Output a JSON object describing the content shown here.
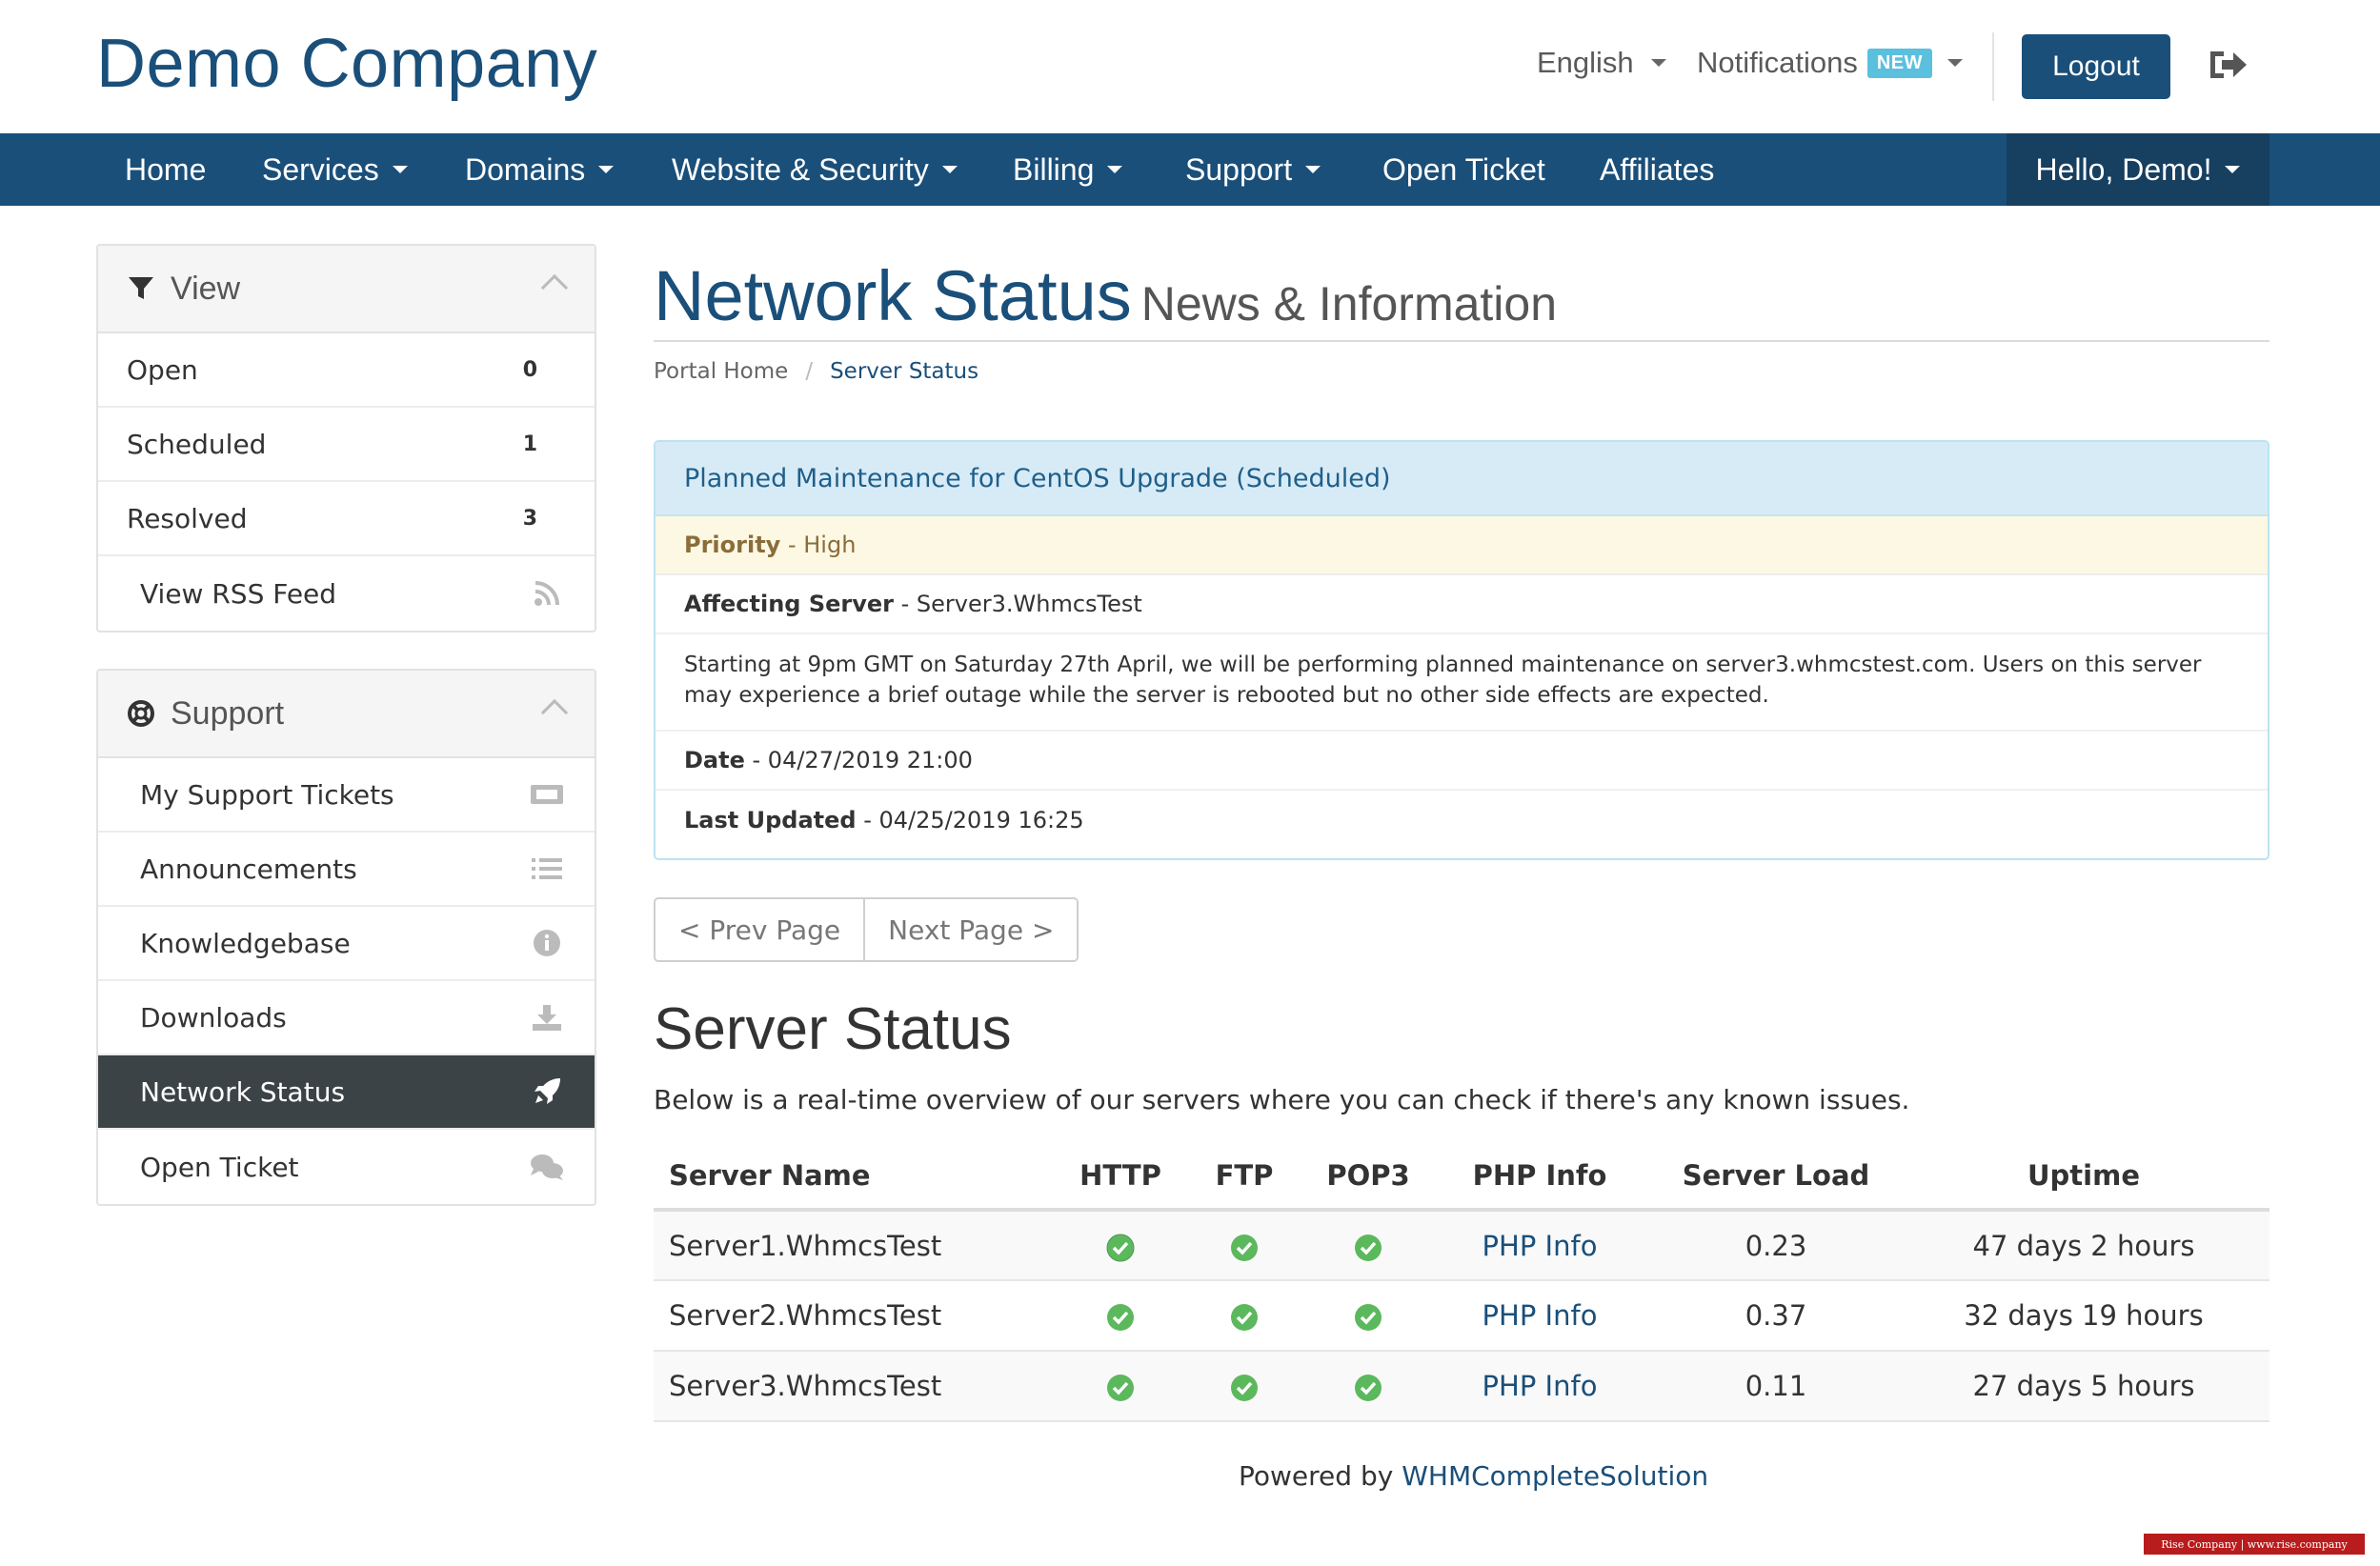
{
  "header": {
    "logo": "Demo Company",
    "language": "English",
    "notifications": "Notifications",
    "notifications_badge": "NEW",
    "logout": "Logout"
  },
  "nav": {
    "items": [
      {
        "label": "Home"
      },
      {
        "label": "Services"
      },
      {
        "label": "Domains"
      },
      {
        "label": "Website & Security"
      },
      {
        "label": "Billing"
      },
      {
        "label": "Support"
      },
      {
        "label": "Open Ticket"
      },
      {
        "label": "Affiliates"
      }
    ],
    "user": "Hello, Demo!"
  },
  "sidebar": {
    "view": {
      "title": "View",
      "items": [
        {
          "label": "Open",
          "count": "0"
        },
        {
          "label": "Scheduled",
          "count": "1"
        },
        {
          "label": "Resolved",
          "count": "3"
        },
        {
          "label": "View RSS Feed",
          "icon": "rss-icon"
        }
      ]
    },
    "support": {
      "title": "Support",
      "items": [
        {
          "label": "My Support Tickets",
          "icon": "ticket-icon"
        },
        {
          "label": "Announcements",
          "icon": "list-icon"
        },
        {
          "label": "Knowledgebase",
          "icon": "info-icon"
        },
        {
          "label": "Downloads",
          "icon": "download-icon"
        },
        {
          "label": "Network Status",
          "icon": "rocket-icon"
        },
        {
          "label": "Open Ticket",
          "icon": "comments-icon"
        }
      ]
    }
  },
  "main": {
    "title": "Network Status",
    "subtitle": "News & Information",
    "breadcrumb": {
      "home": "Portal Home",
      "separator": "/",
      "current": "Server Status"
    },
    "issue": {
      "title": "Planned Maintenance for CentOS Upgrade (Scheduled)",
      "priority_label": "Priority",
      "priority_value": "- High",
      "affecting_label": "Affecting Server",
      "affecting_value": "- Server3.WhmcsTest",
      "description": "Starting at 9pm GMT on Saturday 27th April, we will be performing planned maintenance on server3.whmcstest.com. Users on this server may experience a brief outage while the server is rebooted but no other side effects are expected.",
      "date_label": "Date",
      "date_value": "- 04/27/2019 21:00",
      "updated_label": "Last Updated",
      "updated_value": "- 04/25/2019 16:25"
    },
    "pager": {
      "prev": "< Prev Page",
      "next": "Next Page >"
    },
    "server_status": {
      "title": "Server Status",
      "description": "Below is a real-time overview of our servers where you can check if there's any known issues.",
      "columns": [
        "Server Name",
        "HTTP",
        "FTP",
        "POP3",
        "PHP Info",
        "Server Load",
        "Uptime"
      ],
      "rows": [
        {
          "name": "Server1.WhmcsTest",
          "php": "PHP Info",
          "load": "0.23",
          "uptime": "47 days 2 hours"
        },
        {
          "name": "Server2.WhmcsTest",
          "php": "PHP Info",
          "load": "0.37",
          "uptime": "32 days 19 hours"
        },
        {
          "name": "Server3.WhmcsTest",
          "php": "PHP Info",
          "load": "0.11",
          "uptime": "27 days 5 hours"
        }
      ]
    }
  },
  "footer": {
    "prefix": "Powered by",
    "link": "WHMCompleteSolution"
  },
  "watermark": "Rise Company | www.rise.company",
  "colors": {
    "brand": "#1a4f7a",
    "ok": "#5cb85c",
    "badge": "#5bc0de",
    "active": "#3c4347"
  }
}
